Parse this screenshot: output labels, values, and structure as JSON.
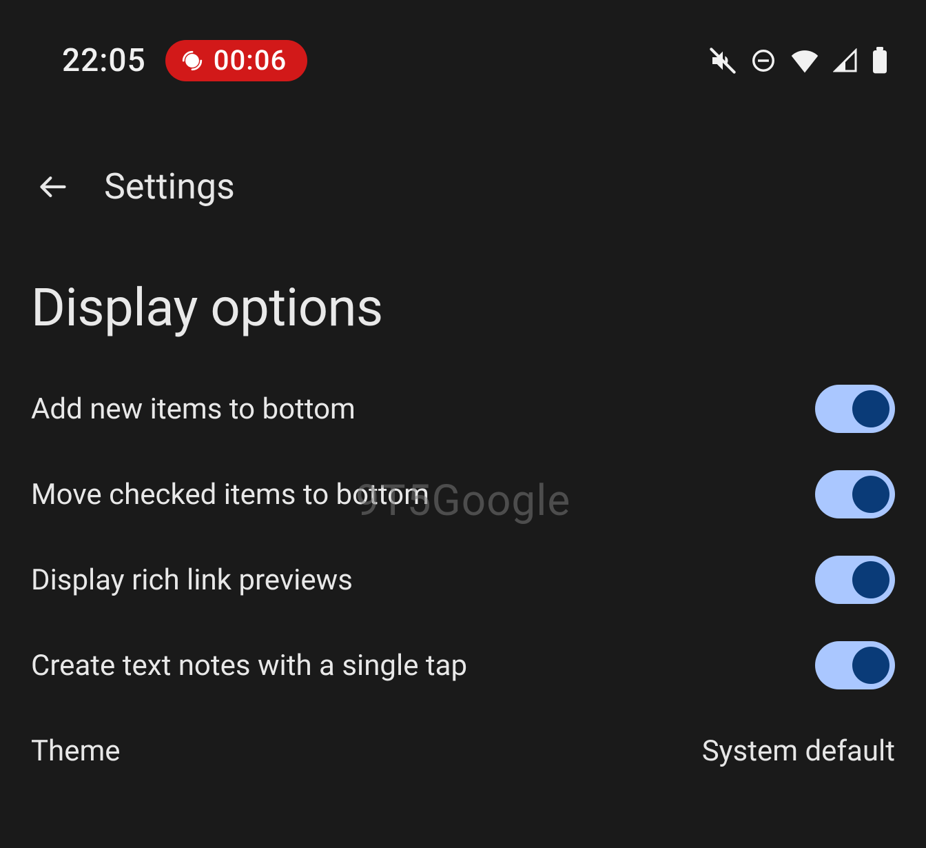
{
  "status_bar": {
    "clock": "22:05",
    "recording_time": "00:06"
  },
  "app_bar": {
    "title": "Settings"
  },
  "section": {
    "title": "Display options"
  },
  "settings": [
    {
      "label": "Add new items to bottom",
      "type": "toggle",
      "value": true
    },
    {
      "label": "Move checked items to bottom",
      "type": "toggle",
      "value": true
    },
    {
      "label": "Display rich link previews",
      "type": "toggle",
      "value": true
    },
    {
      "label": "Create text notes with a single tap",
      "type": "toggle",
      "value": true
    },
    {
      "label": "Theme",
      "type": "value",
      "value": "System default"
    }
  ],
  "watermark": "9T␹5Google"
}
